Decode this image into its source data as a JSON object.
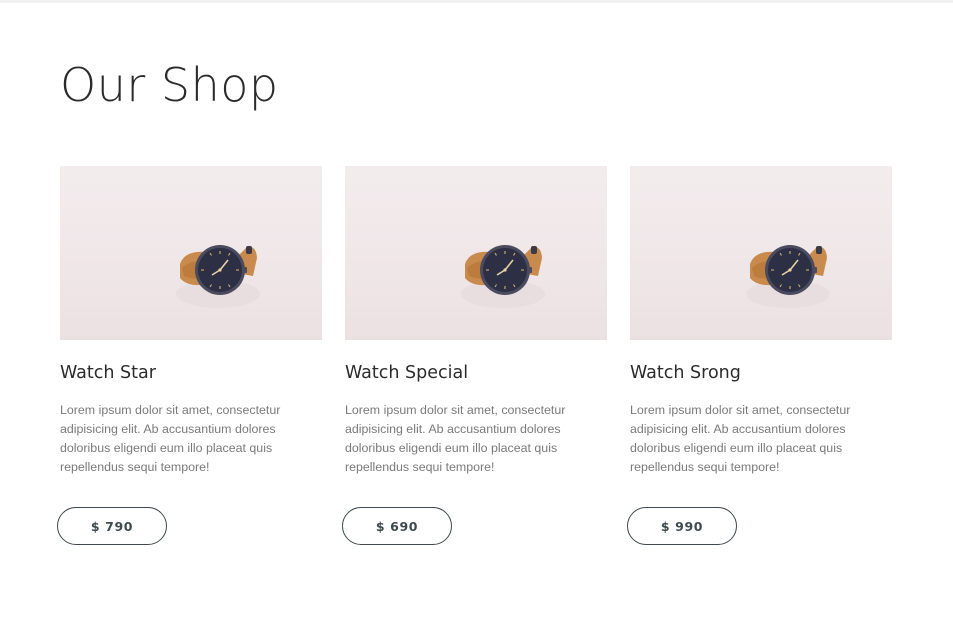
{
  "page": {
    "title": "Our Shop"
  },
  "products": [
    {
      "name": "Watch Star",
      "description": "Lorem ipsum dolor sit amet, consectetur adipisicing elit. Ab accusantium dolores doloribus eligendi eum illo placeat quis repellendus sequi tempore!",
      "price": "$ 790",
      "image_icon": "watch-icon"
    },
    {
      "name": "Watch Special",
      "description": "Lorem ipsum dolor sit amet, consectetur adipisicing elit. Ab accusantium dolores doloribus eligendi eum illo placeat quis repellendus sequi tempore!",
      "price": "$ 690",
      "image_icon": "watch-icon"
    },
    {
      "name": "Watch Srong",
      "description": "Lorem ipsum dolor sit amet, consectetur adipisicing elit. Ab accusantium dolores doloribus eligendi eum illo placeat quis repellendus sequi tempore!",
      "price": "$ 990",
      "image_icon": "watch-icon"
    }
  ],
  "colors": {
    "text_dark": "#2b2b2b",
    "text_muted": "#7a7a7a",
    "button_border": "#3d4a4e",
    "photo_background": "#f0e8ea",
    "watch_face": "#2d2f45",
    "watch_strap": "#c98a4e"
  }
}
